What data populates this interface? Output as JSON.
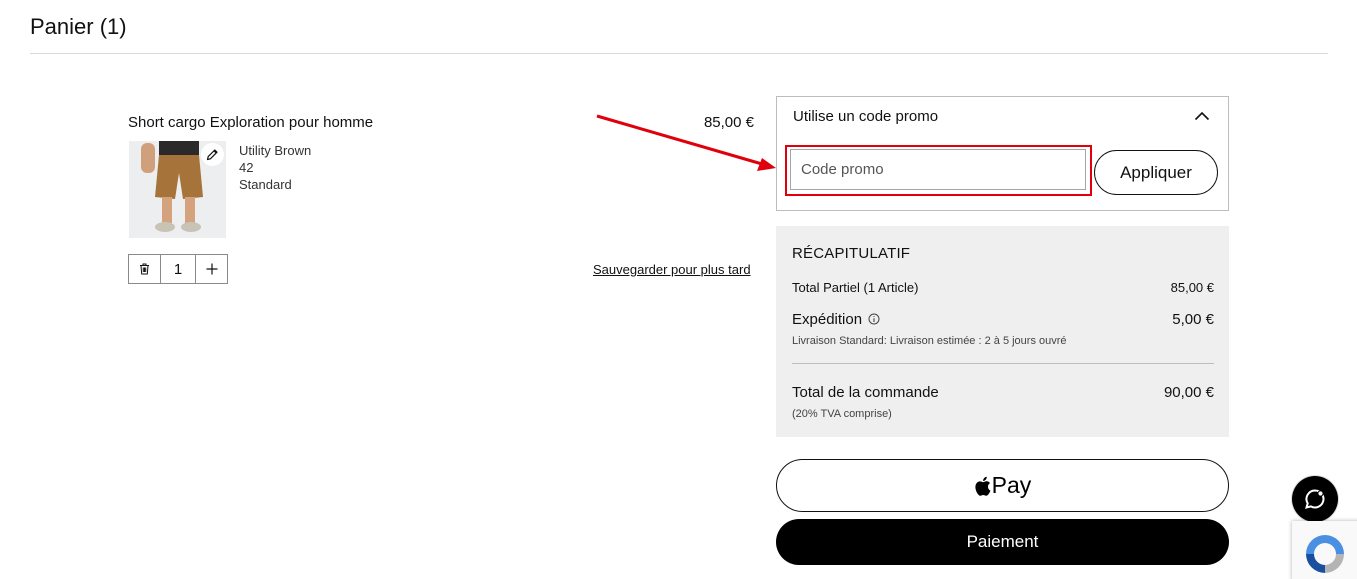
{
  "page": {
    "title": "Panier (1)"
  },
  "item": {
    "name": "Short cargo Exploration pour homme",
    "price": "85,00 €",
    "color": "Utility Brown",
    "size": "42",
    "fit": "Standard",
    "quantity": "1",
    "save_later_label": "Sauvegarder pour plus tard"
  },
  "promo": {
    "title": "Utilise un code promo",
    "placeholder": "Code promo",
    "apply_label": "Appliquer"
  },
  "summary": {
    "title": "RÉCAPITULATIF",
    "subtotal_label": "Total Partiel (1 Article)",
    "subtotal_value": "85,00 €",
    "shipping_label": "Expédition",
    "shipping_value": "5,00 €",
    "shipping_note": "Livraison Standard: Livraison estimée : 2 à 5 jours ouvré",
    "total_label": "Total de la commande",
    "total_value": "90,00 €",
    "vat_note": "(20% TVA comprise)"
  },
  "checkout": {
    "applepay_label": "Pay",
    "pay_label": "Paiement"
  },
  "colors": {
    "highlight": "#e0000b",
    "primary_button": "#000000",
    "summary_bg": "#efefef"
  },
  "icons": [
    "pencil-icon",
    "trash-icon",
    "plus-icon",
    "chevron-up-icon",
    "info-icon",
    "apple-logo-icon",
    "chat-icon",
    "recaptcha-icon",
    "annotation-arrow"
  ]
}
